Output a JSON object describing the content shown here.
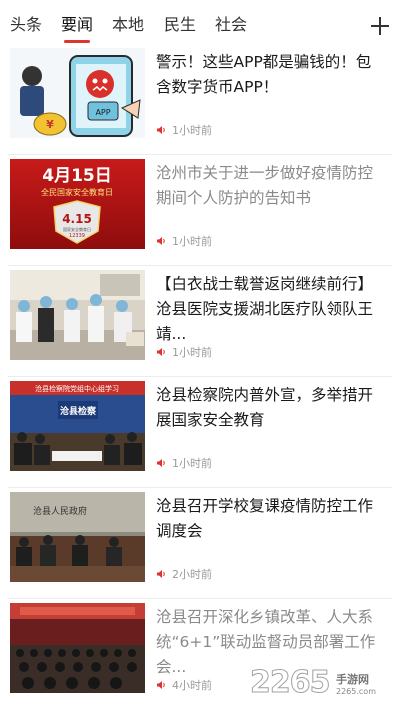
{
  "tabs": [
    {
      "label": "头条"
    },
    {
      "label": "要闻"
    },
    {
      "label": "本地"
    },
    {
      "label": "民生"
    },
    {
      "label": "社会"
    }
  ],
  "active_tab": "要闻",
  "colors": {
    "accent": "#e0322f",
    "read_title": "#8a8a8a",
    "meta": "#9a9a9a"
  },
  "news": [
    {
      "title": "警示！这些APP都是骗钱的！包含数字货币APP！",
      "time": "1小时前",
      "read": false,
      "thumb_text": {
        "app": "APP"
      }
    },
    {
      "title": "沧州市关于进一步做好疫情防控期间个人防护的告知书",
      "time": "1小时前",
      "read": true,
      "thumb_text": {
        "date": "4月15日",
        "sub": "全民国家安全教育日",
        "num": "4.15",
        "small": "国家安全教育日",
        "phone": "12339"
      }
    },
    {
      "title": "【白衣战士载誉返岗继续前行】沧县医院支援湖北医疗队领队王靖...",
      "time": "1小时前",
      "read": false
    },
    {
      "title": "沧县检察院内普外宣，多举措开展国家安全教育",
      "time": "1小时前",
      "read": false,
      "thumb_text": {
        "banner": "沧县检察院党组中心组学习",
        "sign": "沧县检察"
      }
    },
    {
      "title": "沧县召开学校复课疫情防控工作调度会",
      "time": "2小时前",
      "read": false,
      "thumb_text": {
        "wall": "沧县人民政府"
      }
    },
    {
      "title": "沧县召开深化乡镇改革、人大系统“6+1”联动监督动员部署工作会...",
      "time": "4小时前",
      "read": true
    }
  ],
  "watermark": {
    "number": "2265",
    "name": "手游网",
    "url": "2265.com"
  }
}
